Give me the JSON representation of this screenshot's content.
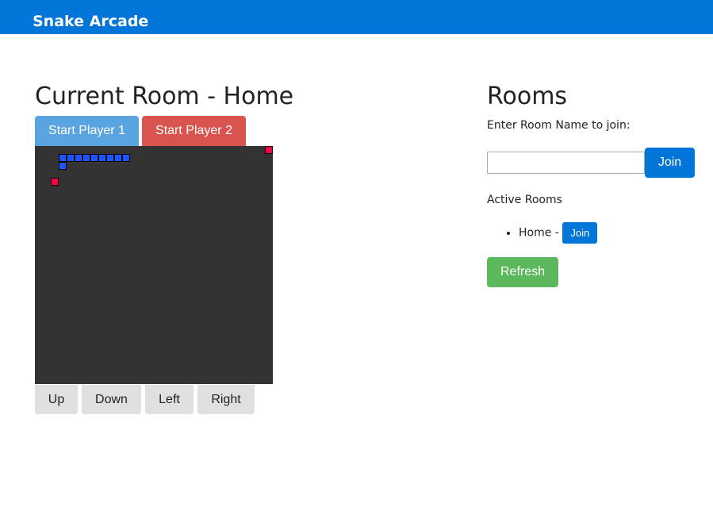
{
  "navbar": {
    "brand": "Snake Arcade",
    "color": "#0275d8"
  },
  "game": {
    "title": "Current Room - Home",
    "start_p1_label": "Start Player 1",
    "start_p2_label": "Start Player 2",
    "controls": {
      "up": "Up",
      "down": "Down",
      "left": "Left",
      "right": "Right"
    },
    "board": {
      "background": "#333333",
      "grid_size": 30,
      "snake_color": "#1a55ff",
      "food_color": "#ff0044",
      "snake_cells": [
        [
          3,
          1
        ],
        [
          4,
          1
        ],
        [
          5,
          1
        ],
        [
          6,
          1
        ],
        [
          7,
          1
        ],
        [
          8,
          1
        ],
        [
          9,
          1
        ],
        [
          10,
          1
        ],
        [
          11,
          1
        ],
        [
          3,
          2
        ]
      ],
      "food_cells": [
        [
          2,
          4
        ],
        [
          29,
          0
        ]
      ]
    }
  },
  "rooms": {
    "title": "Rooms",
    "join_prompt": "Enter Room Name to join:",
    "input_value": "",
    "input_placeholder": "",
    "join_label": "Join",
    "active_label": "Active Rooms",
    "active_rooms": [
      {
        "name": "Home",
        "separator": " - ",
        "join_label": "Join"
      }
    ],
    "refresh_label": "Refresh"
  }
}
